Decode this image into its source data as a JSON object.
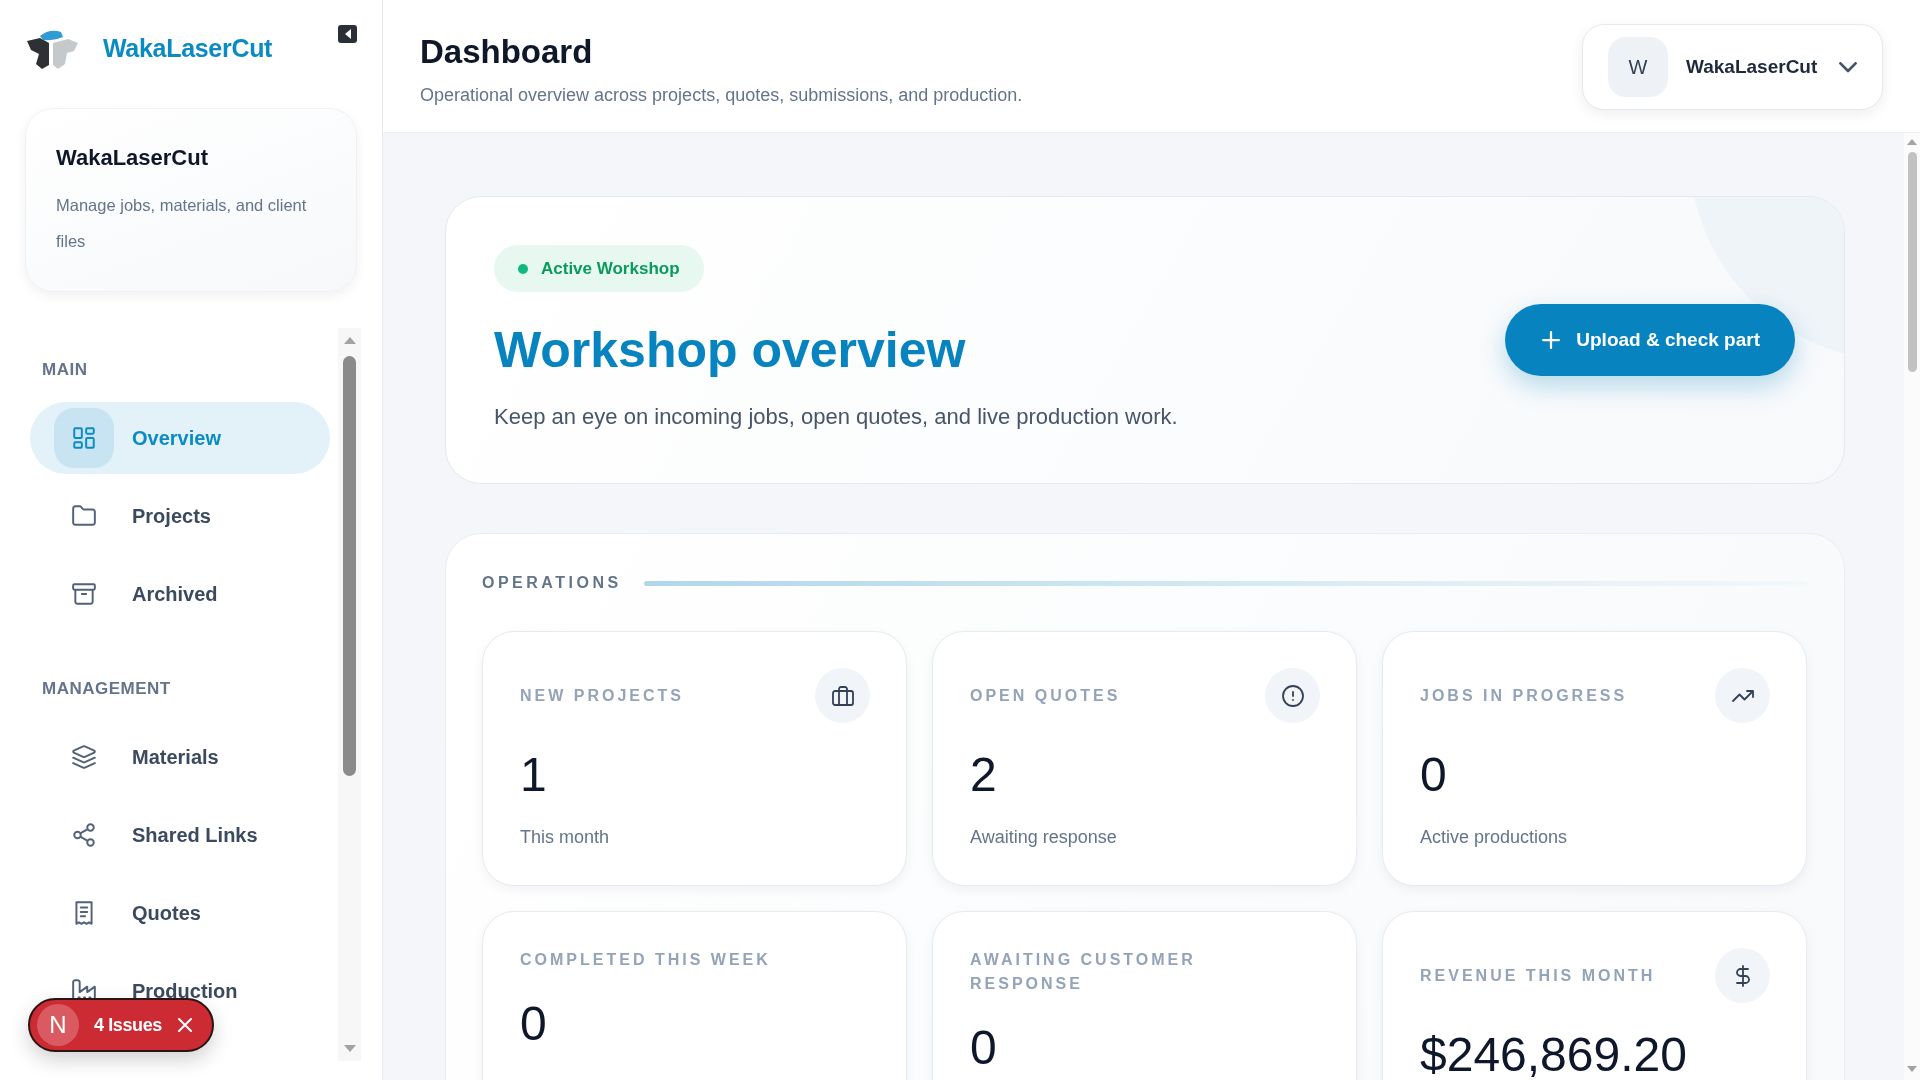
{
  "sidebar": {
    "brand": "WakaLaserCut",
    "workspace": {
      "name": "WakaLaserCut",
      "description": "Manage jobs, materials, and client files"
    },
    "sections": [
      {
        "heading": "MAIN",
        "items": [
          {
            "label": "Overview",
            "selected": true
          },
          {
            "label": "Projects",
            "selected": false
          },
          {
            "label": "Archived",
            "selected": false
          }
        ]
      },
      {
        "heading": "MANAGEMENT",
        "items": [
          {
            "label": "Materials",
            "selected": false
          },
          {
            "label": "Shared Links",
            "selected": false
          },
          {
            "label": "Quotes",
            "selected": false
          },
          {
            "label": "Production",
            "selected": false
          }
        ]
      }
    ]
  },
  "issues_badge": {
    "avatar": "N",
    "label": "4 Issues"
  },
  "header": {
    "title": "Dashboard",
    "subtitle": "Operational overview across projects, quotes, submissions, and production.",
    "account": {
      "avatar": "W",
      "name": "WakaLaserCut"
    }
  },
  "hero": {
    "status": "Active Workshop",
    "title": "Workshop overview",
    "description": "Keep an eye on incoming jobs, open quotes, and live production work.",
    "action": "Upload & check part"
  },
  "operations": {
    "heading": "OPERATIONS",
    "stats": [
      {
        "label": "NEW PROJECTS",
        "value": "1",
        "caption": "This month"
      },
      {
        "label": "OPEN QUOTES",
        "value": "2",
        "caption": "Awaiting response"
      },
      {
        "label": "JOBS IN PROGRESS",
        "value": "0",
        "caption": "Active productions"
      },
      {
        "label": "COMPLETED THIS WEEK",
        "value": "0"
      },
      {
        "label": "AWAITING CUSTOMER RESPONSE",
        "value": "0"
      },
      {
        "label": "REVENUE THIS MONTH",
        "value": "$246,869.20"
      }
    ]
  }
}
